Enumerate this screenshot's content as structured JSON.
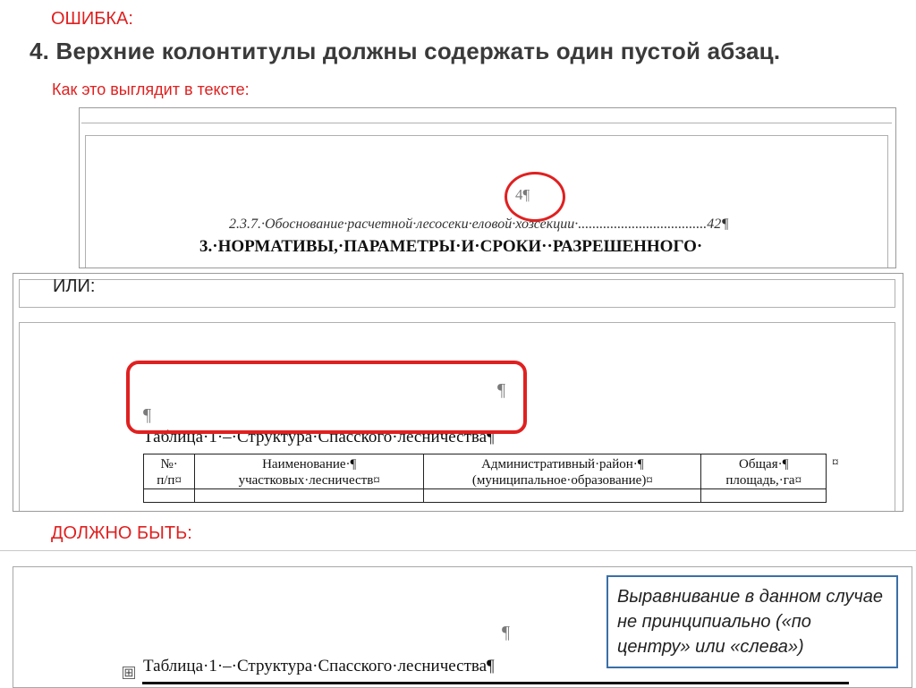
{
  "error_label": "ОШИБКА:",
  "rule_heading": "4. Верхние колонтитулы должны содержать один пустой абзац.",
  "how_label": "Как это выглядит в тексте:",
  "example1": {
    "page_number_mark": "4¶",
    "toc_entry": "2.3.7.·Обоснование·расчетной·лесосеки·еловой·хозсекции·....................................42¶",
    "section_heading": "3.·НОРМАТИВЫ,·ПАРАМЕТРЫ·И·СРОКИ··РАЗРЕШЕННОГО·"
  },
  "or_label": "ИЛИ:",
  "example2": {
    "pilcrow_right": "¶",
    "pilcrow_left": "¶",
    "table_caption": "Таблица·1·–·Структура·Спасского·лесничества¶",
    "table_headers": [
      [
        "№·",
        "п/п¤"
      ],
      [
        "Наименование·¶",
        "участковых·лесничеств¤"
      ],
      [
        "Административный·район·¶",
        "(муниципальное·образование)¤"
      ],
      [
        "Общая·¶",
        "площадь,·га¤"
      ]
    ],
    "row_end_mark": "¤"
  },
  "should_be_label": "ДОЛЖНО БЫТЬ:",
  "example3": {
    "pilcrow": "¶",
    "move_handle": "⊞",
    "table_caption": "Таблица·1·–·Структура·Спасского·лесничества¶"
  },
  "note": "Выравнивание в данном случае не принципиально («по центру» или «слева»)",
  "colors": {
    "error_red": "#e02020",
    "note_border": "#3a6fa8"
  }
}
